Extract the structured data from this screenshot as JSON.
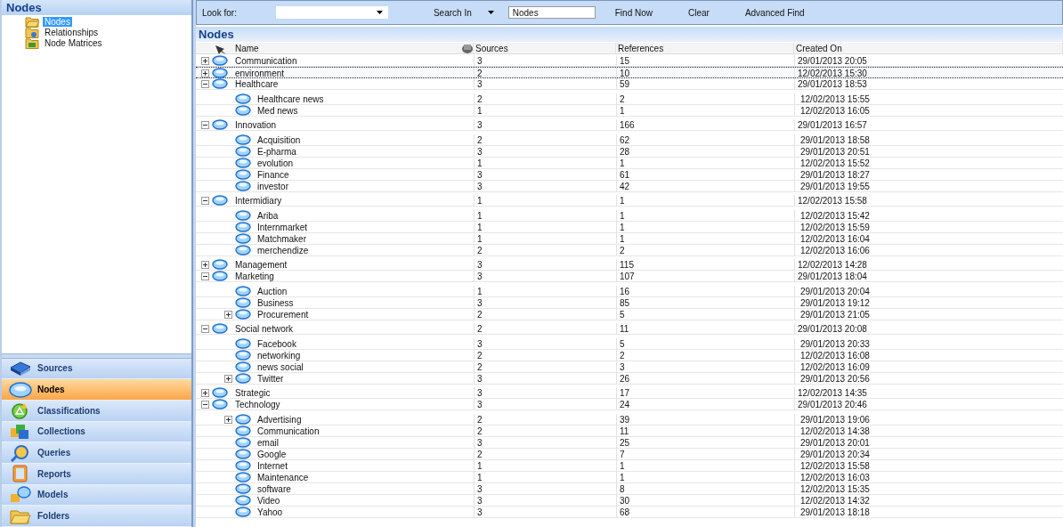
{
  "navigation_pane": {
    "title": "Nodes",
    "tree": [
      {
        "label": "Nodes",
        "selected": true
      },
      {
        "label": "Relationships",
        "selected": false
      },
      {
        "label": "Node Matrices",
        "selected": false
      }
    ],
    "buttons": [
      {
        "label": "Sources",
        "selected": false
      },
      {
        "label": "Nodes",
        "selected": true
      },
      {
        "label": "Classifications",
        "selected": false
      },
      {
        "label": "Collections",
        "selected": false
      },
      {
        "label": "Queries",
        "selected": false
      },
      {
        "label": "Reports",
        "selected": false
      },
      {
        "label": "Models",
        "selected": false
      },
      {
        "label": "Folders",
        "selected": false
      }
    ]
  },
  "find_bar": {
    "look_for_label": "Look for:",
    "search_in_label": "Search In",
    "search_in_value": "Nodes",
    "buttons": [
      "Find Now",
      "Clear",
      "Advanced Find"
    ]
  },
  "list_view": {
    "title": "Nodes",
    "columns": [
      "Name",
      "Sources",
      "References",
      "Created On"
    ],
    "rows": [
      {
        "name": "Communication",
        "sources": "3",
        "references": "15",
        "created_on": "29/01/2013 20:05",
        "expanded": false,
        "focused": false
      },
      {
        "name": "environment",
        "sources": "2",
        "references": "10",
        "created_on": "12/02/2013 15:30",
        "expanded": false,
        "focused": true
      },
      {
        "name": "Healthcare",
        "sources": "3",
        "references": "59",
        "created_on": "29/01/2013 18:53",
        "expanded": true,
        "focused": false,
        "children": [
          {
            "name": "Healthcare news",
            "sources": "2",
            "references": "2",
            "created_on": "12/02/2013 15:55",
            "focused": false
          },
          {
            "name": "Med news",
            "sources": "1",
            "references": "1",
            "created_on": "12/02/2013 16:05",
            "focused": false
          }
        ]
      },
      {
        "name": "Innovation",
        "sources": "3",
        "references": "166",
        "created_on": "29/01/2013 16:57",
        "expanded": true,
        "focused": false,
        "children": [
          {
            "name": "Acquisition",
            "sources": "2",
            "references": "62",
            "created_on": "29/01/2013 18:58",
            "focused": false
          },
          {
            "name": "E-pharma",
            "sources": "3",
            "references": "28",
            "created_on": "29/01/2013 20:51",
            "focused": false
          },
          {
            "name": "evolution",
            "sources": "1",
            "references": "1",
            "created_on": "12/02/2013 15:52",
            "focused": false
          },
          {
            "name": "Finance",
            "sources": "3",
            "references": "61",
            "created_on": "29/01/2013 18:27",
            "focused": false
          },
          {
            "name": "investor",
            "sources": "3",
            "references": "42",
            "created_on": "29/01/2013 19:55",
            "focused": false
          }
        ]
      },
      {
        "name": "Intermidiary",
        "sources": "1",
        "references": "1",
        "created_on": "12/02/2013 15:58",
        "expanded": true,
        "focused": false,
        "children": [
          {
            "name": "Ariba",
            "sources": "1",
            "references": "1",
            "created_on": "12/02/2013 15:42",
            "focused": false
          },
          {
            "name": "Internmarket",
            "sources": "1",
            "references": "1",
            "created_on": "12/02/2013 15:59",
            "focused": false
          },
          {
            "name": "Matchmaker",
            "sources": "1",
            "references": "1",
            "created_on": "12/02/2013 16:04",
            "focused": false
          },
          {
            "name": "merchendize",
            "sources": "2",
            "references": "2",
            "created_on": "12/02/2013 16:06",
            "focused": false
          }
        ]
      },
      {
        "name": "Management",
        "sources": "3",
        "references": "115",
        "created_on": "12/02/2013 14:28",
        "expanded": false,
        "focused": false
      },
      {
        "name": "Marketing",
        "sources": "3",
        "references": "107",
        "created_on": "29/01/2013 18:04",
        "expanded": true,
        "focused": false,
        "children": [
          {
            "name": "Auction",
            "sources": "1",
            "references": "16",
            "created_on": "29/01/2013 20:04",
            "focused": false
          },
          {
            "name": "Business",
            "sources": "3",
            "references": "85",
            "created_on": "29/01/2013 19:12",
            "focused": false
          },
          {
            "name": "Procurement",
            "sources": "2",
            "references": "5",
            "created_on": "29/01/2013 21:05",
            "expanded": false,
            "focused": false
          }
        ]
      },
      {
        "name": "Social network",
        "sources": "2",
        "references": "11",
        "created_on": "29/01/2013 20:08",
        "expanded": true,
        "focused": false,
        "children": [
          {
            "name": "Facebook",
            "sources": "3",
            "references": "5",
            "created_on": "29/01/2013 20:33",
            "focused": false
          },
          {
            "name": "networking",
            "sources": "2",
            "references": "2",
            "created_on": "12/02/2013 16:08",
            "focused": false
          },
          {
            "name": "news social",
            "sources": "2",
            "references": "3",
            "created_on": "12/02/2013 16:09",
            "focused": false
          },
          {
            "name": "Twitter",
            "sources": "3",
            "references": "26",
            "created_on": "29/01/2013 20:56",
            "expanded": false,
            "focused": false
          }
        ]
      },
      {
        "name": "Strategic",
        "sources": "3",
        "references": "17",
        "created_on": "12/02/2013 14:35",
        "expanded": false,
        "focused": false
      },
      {
        "name": "Technology",
        "sources": "3",
        "references": "24",
        "created_on": "29/01/2013 20:46",
        "expanded": true,
        "focused": false,
        "children": [
          {
            "name": "Advertising",
            "sources": "2",
            "references": "39",
            "created_on": "29/01/2013 19:06",
            "expanded": false,
            "focused": false
          },
          {
            "name": "Communication",
            "sources": "2",
            "references": "11",
            "created_on": "12/02/2013 14:38",
            "focused": false
          },
          {
            "name": "email",
            "sources": "3",
            "references": "25",
            "created_on": "29/01/2013 20:01",
            "focused": false
          },
          {
            "name": "Google",
            "sources": "2",
            "references": "7",
            "created_on": "29/01/2013 20:34",
            "focused": false
          },
          {
            "name": "Internet",
            "sources": "1",
            "references": "1",
            "created_on": "12/02/2013 15:58",
            "focused": false
          },
          {
            "name": "Maintenance",
            "sources": "1",
            "references": "1",
            "created_on": "12/02/2013 16:03",
            "focused": false
          },
          {
            "name": "software",
            "sources": "3",
            "references": "8",
            "created_on": "12/02/2013 15:35",
            "focused": false
          },
          {
            "name": "Video",
            "sources": "3",
            "references": "30",
            "created_on": "12/02/2013 14:32",
            "focused": false
          },
          {
            "name": "Yahoo",
            "sources": "3",
            "references": "68",
            "created_on": "29/01/2013 18:18",
            "focused": false
          }
        ]
      }
    ]
  }
}
